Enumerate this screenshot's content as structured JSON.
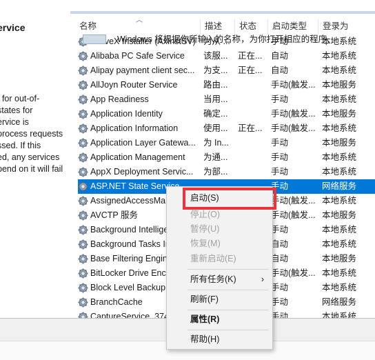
{
  "left_panel": {
    "title": "ervice",
    "description_lines": [
      "t for out-of-",
      "states for",
      "ervice is",
      "process requests",
      "ssed. If this",
      "ed, any services",
      "pend on it will fail"
    ]
  },
  "columns": {
    "name": "名称",
    "description": "描述",
    "status": "状态",
    "startup": "启动类型",
    "logon": "登录为"
  },
  "services": [
    {
      "name": "ActiveX Installer (AxInstSV)",
      "desc": "为从 ...",
      "status": "",
      "startup": "手动",
      "logon": "本地系统"
    },
    {
      "name": "Alibaba PC Safe Service",
      "desc": "该服...",
      "status": "正在...",
      "startup": "自动",
      "logon": "本地系统"
    },
    {
      "name": "Alipay payment client sec...",
      "desc": "为支...",
      "status": "正在...",
      "startup": "自动",
      "logon": "本地系统"
    },
    {
      "name": "AllJoyn Router Service",
      "desc": "路由...",
      "status": "",
      "startup": "手动(触发...",
      "logon": "本地服务"
    },
    {
      "name": "App Readiness",
      "desc": "当用...",
      "status": "",
      "startup": "手动",
      "logon": "本地系统"
    },
    {
      "name": "Application Identity",
      "desc": "确定...",
      "status": "",
      "startup": "手动(触发...",
      "logon": "本地服务"
    },
    {
      "name": "Application Information",
      "desc": "使用...",
      "status": "正在...",
      "startup": "手动(触发...",
      "logon": "本地系统"
    },
    {
      "name": "Application Layer Gatewa...",
      "desc": "为 In...",
      "status": "",
      "startup": "手动",
      "logon": "本地服务"
    },
    {
      "name": "Application Management",
      "desc": "为通...",
      "status": "",
      "startup": "手动",
      "logon": "本地系统"
    },
    {
      "name": "AppX Deployment Servic...",
      "desc": "为部...",
      "status": "",
      "startup": "手动",
      "logon": "本地系统"
    },
    {
      "name": "ASP.NET State Service",
      "desc": "",
      "status": "",
      "startup": "手动",
      "logon": "网络服务",
      "selected": true
    },
    {
      "name": "AssignedAccessManager...",
      "desc": "",
      "status": "",
      "startup": "手动(触发...",
      "logon": "本地系统"
    },
    {
      "name": "AVCTP 服务",
      "desc": "",
      "status": "",
      "startup": "手动(触发...",
      "logon": "本地服务"
    },
    {
      "name": "Background Intelligent...",
      "desc": "",
      "status": "",
      "startup": "手动",
      "logon": "本地系统"
    },
    {
      "name": "Background Tasks Infra...",
      "desc": "",
      "status": "",
      "startup": "自动",
      "logon": "本地系统"
    },
    {
      "name": "Base Filtering Engine",
      "desc": "",
      "status": "",
      "startup": "自动",
      "logon": "本地服务"
    },
    {
      "name": "BitLocker Drive Encrypt...",
      "desc": "",
      "status": "",
      "startup": "手动(触发...",
      "logon": "本地系统"
    },
    {
      "name": "Block Level Backup Eng...",
      "desc": "",
      "status": "",
      "startup": "手动",
      "logon": "本地系统"
    },
    {
      "name": "BranchCache",
      "desc": "",
      "status": "",
      "startup": "手动",
      "logon": "网络服务"
    },
    {
      "name": "CaptureService_374...",
      "desc": "",
      "status": "",
      "startup": "手动",
      "logon": "本地系统"
    }
  ],
  "context_menu": {
    "start": "启动(S)",
    "stop": "停止(O)",
    "pause": "暂停(U)",
    "resume": "恢复(M)",
    "restart": "重新启动(E)",
    "all_tasks": "所有任务(K)",
    "refresh": "刷新(F)",
    "properties": "属性(R)",
    "help": "帮助(H)",
    "submenu_arrow": "›"
  },
  "bottom": {
    "hint": "Windows 将根据你所输入的名称，为你打开相应的程序、"
  },
  "colors": {
    "selection": "#0078d7",
    "highlight_box": "#e8343a"
  }
}
